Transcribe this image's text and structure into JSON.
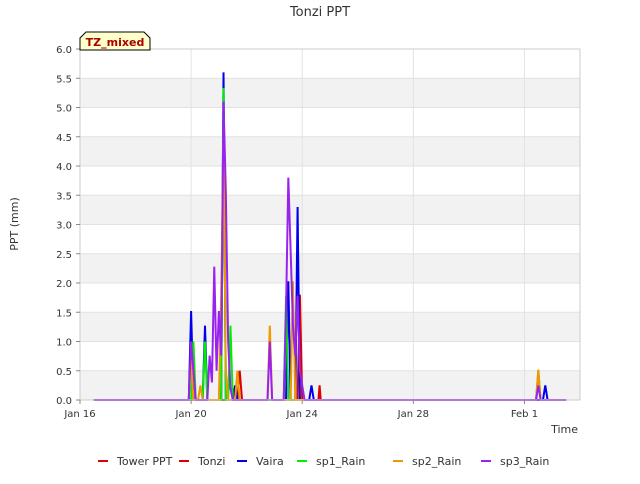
{
  "chart_data": {
    "type": "line",
    "title": "Tonzi PPT",
    "xlabel": "Time",
    "ylabel": "PPT (mm)",
    "badge": "TZ_mixed",
    "x_domain": [
      "2024-01-16",
      "2024-02-03"
    ],
    "ylim": [
      0,
      6
    ],
    "yticks": [
      "0.0",
      "0.5",
      "1.0",
      "1.5",
      "2.0",
      "2.5",
      "3.0",
      "3.5",
      "4.0",
      "4.5",
      "5.0",
      "5.5",
      "6.0"
    ],
    "xticks": [
      {
        "date": "2024-01-16",
        "label": "Jan 16"
      },
      {
        "date": "2024-01-20",
        "label": "Jan 20"
      },
      {
        "date": "2024-01-24",
        "label": "Jan 24"
      },
      {
        "date": "2024-01-28",
        "label": "Jan 28"
      },
      {
        "date": "2024-02-01",
        "label": "Feb 1"
      }
    ],
    "grid": true,
    "legend_position": "bottom",
    "series": [
      {
        "name": "Tower PPT",
        "color": "#dd0000",
        "points": [
          [
            "2024-01-16T12:00",
            0
          ],
          [
            "2024-02-02T12:00",
            0
          ]
        ]
      },
      {
        "name": "Tonzi",
        "color": "#dd0000",
        "points": [
          [
            "2024-01-16T12:00",
            0
          ],
          [
            "2024-01-21T16:00",
            0
          ],
          [
            "2024-01-21T18:00",
            0.5
          ],
          [
            "2024-01-21T20:00",
            0
          ],
          [
            "2024-01-23T20:00",
            0
          ],
          [
            "2024-01-23T22:00",
            1.8
          ],
          [
            "2024-01-24T00:00",
            0
          ],
          [
            "2024-01-24T14:00",
            0
          ],
          [
            "2024-01-24T15:00",
            0.25
          ],
          [
            "2024-01-24T16:00",
            0
          ],
          [
            "2024-02-02T12:00",
            0
          ]
        ]
      },
      {
        "name": "Vaira",
        "color": "#0000ee",
        "points": [
          [
            "2024-01-16T12:00",
            0
          ],
          [
            "2024-01-19T22:00",
            0
          ],
          [
            "2024-01-20T00:00",
            1.52
          ],
          [
            "2024-01-20T02:00",
            0
          ],
          [
            "2024-01-20T10:00",
            0
          ],
          [
            "2024-01-20T12:00",
            1.27
          ],
          [
            "2024-01-20T14:00",
            0
          ],
          [
            "2024-01-21T02:00",
            0
          ],
          [
            "2024-01-21T04:00",
            5.6
          ],
          [
            "2024-01-21T06:00",
            0
          ],
          [
            "2024-01-21T12:00",
            0
          ],
          [
            "2024-01-21T14:00",
            0.25
          ],
          [
            "2024-01-21T16:00",
            0
          ],
          [
            "2024-01-23T10:00",
            0
          ],
          [
            "2024-01-23T12:00",
            2.03
          ],
          [
            "2024-01-23T14:00",
            0
          ],
          [
            "2024-01-23T18:00",
            0
          ],
          [
            "2024-01-23T20:00",
            3.3
          ],
          [
            "2024-01-23T22:00",
            0
          ],
          [
            "2024-01-24T06:00",
            0
          ],
          [
            "2024-01-24T08:00",
            0.25
          ],
          [
            "2024-01-24T10:00",
            0
          ],
          [
            "2024-02-01T16:00",
            0
          ],
          [
            "2024-02-01T18:00",
            0.25
          ],
          [
            "2024-02-01T20:00",
            0
          ],
          [
            "2024-02-02T12:00",
            0
          ]
        ]
      },
      {
        "name": "sp1_Rain",
        "color": "#00ee00",
        "points": [
          [
            "2024-01-16T12:00",
            0
          ],
          [
            "2024-01-20T00:00",
            0
          ],
          [
            "2024-01-20T02:00",
            1.0
          ],
          [
            "2024-01-20T04:00",
            0
          ],
          [
            "2024-01-20T10:00",
            0
          ],
          [
            "2024-01-20T12:00",
            1.0
          ],
          [
            "2024-01-20T14:00",
            0
          ],
          [
            "2024-01-21T02:00",
            0
          ],
          [
            "2024-01-21T04:00",
            5.33
          ],
          [
            "2024-01-21T06:00",
            0
          ],
          [
            "2024-01-21T08:00",
            0
          ],
          [
            "2024-01-21T10:00",
            1.27
          ],
          [
            "2024-01-21T12:00",
            0
          ],
          [
            "2024-01-23T08:00",
            0
          ],
          [
            "2024-01-23T10:00",
            1.78
          ],
          [
            "2024-01-23T12:00",
            0
          ],
          [
            "2024-02-01T10:00",
            0
          ],
          [
            "2024-02-01T12:00",
            0.5
          ],
          [
            "2024-02-01T14:00",
            0
          ],
          [
            "2024-02-02T12:00",
            0
          ]
        ]
      },
      {
        "name": "sp2_Rain",
        "color": "#ee9900",
        "points": [
          [
            "2024-01-16T12:00",
            0
          ],
          [
            "2024-01-19T22:00",
            0
          ],
          [
            "2024-01-20T00:00",
            0.76
          ],
          [
            "2024-01-20T02:00",
            0
          ],
          [
            "2024-01-20T06:00",
            0
          ],
          [
            "2024-01-20T08:00",
            0.25
          ],
          [
            "2024-01-20T10:00",
            0
          ],
          [
            "2024-01-21T00:00",
            0
          ],
          [
            "2024-01-21T02:00",
            1.8
          ],
          [
            "2024-01-21T04:00",
            4.57
          ],
          [
            "2024-01-21T06:00",
            0.5
          ],
          [
            "2024-01-21T08:00",
            0
          ],
          [
            "2024-01-21T14:00",
            0
          ],
          [
            "2024-01-21T16:00",
            0.5
          ],
          [
            "2024-01-21T18:00",
            0
          ],
          [
            "2024-01-22T18:00",
            0
          ],
          [
            "2024-01-22T20:00",
            1.27
          ],
          [
            "2024-01-22T22:00",
            0
          ],
          [
            "2024-01-23T14:00",
            0
          ],
          [
            "2024-01-23T16:00",
            2.03
          ],
          [
            "2024-01-23T18:00",
            0
          ],
          [
            "2024-02-01T10:00",
            0
          ],
          [
            "2024-02-01T12:00",
            0.52
          ],
          [
            "2024-02-01T14:00",
            0
          ],
          [
            "2024-02-02T12:00",
            0
          ]
        ]
      },
      {
        "name": "sp3_Rain",
        "color": "#9922ee",
        "points": [
          [
            "2024-01-16T12:00",
            0
          ],
          [
            "2024-01-19T22:00",
            0
          ],
          [
            "2024-01-20T00:00",
            1.0
          ],
          [
            "2024-01-20T02:00",
            0.5
          ],
          [
            "2024-01-20T04:00",
            0
          ],
          [
            "2024-01-20T14:00",
            0
          ],
          [
            "2024-01-20T16:00",
            0.76
          ],
          [
            "2024-01-20T18:00",
            0.3
          ],
          [
            "2024-01-20T20:00",
            2.28
          ],
          [
            "2024-01-20T22:00",
            0.5
          ],
          [
            "2024-01-21T00:00",
            1.52
          ],
          [
            "2024-01-21T02:00",
            0.76
          ],
          [
            "2024-01-21T04:00",
            5.1
          ],
          [
            "2024-01-21T06:00",
            3.55
          ],
          [
            "2024-01-21T08:00",
            1.0
          ],
          [
            "2024-01-21T10:00",
            0.2
          ],
          [
            "2024-01-21T12:00",
            0
          ],
          [
            "2024-01-22T18:00",
            0
          ],
          [
            "2024-01-22T20:00",
            1.0
          ],
          [
            "2024-01-22T22:00",
            0
          ],
          [
            "2024-01-23T08:00",
            0
          ],
          [
            "2024-01-23T10:00",
            1.52
          ],
          [
            "2024-01-23T12:00",
            3.8
          ],
          [
            "2024-01-23T14:00",
            2.54
          ],
          [
            "2024-01-23T16:00",
            1.27
          ],
          [
            "2024-01-23T18:00",
            0.76
          ],
          [
            "2024-01-23T20:00",
            1.78
          ],
          [
            "2024-01-23T22:00",
            0.5
          ],
          [
            "2024-01-24T00:00",
            0.25
          ],
          [
            "2024-01-24T02:00",
            0
          ],
          [
            "2024-02-01T10:00",
            0
          ],
          [
            "2024-02-01T12:00",
            0.25
          ],
          [
            "2024-02-01T14:00",
            0
          ],
          [
            "2024-02-02T12:00",
            0
          ]
        ]
      }
    ]
  }
}
